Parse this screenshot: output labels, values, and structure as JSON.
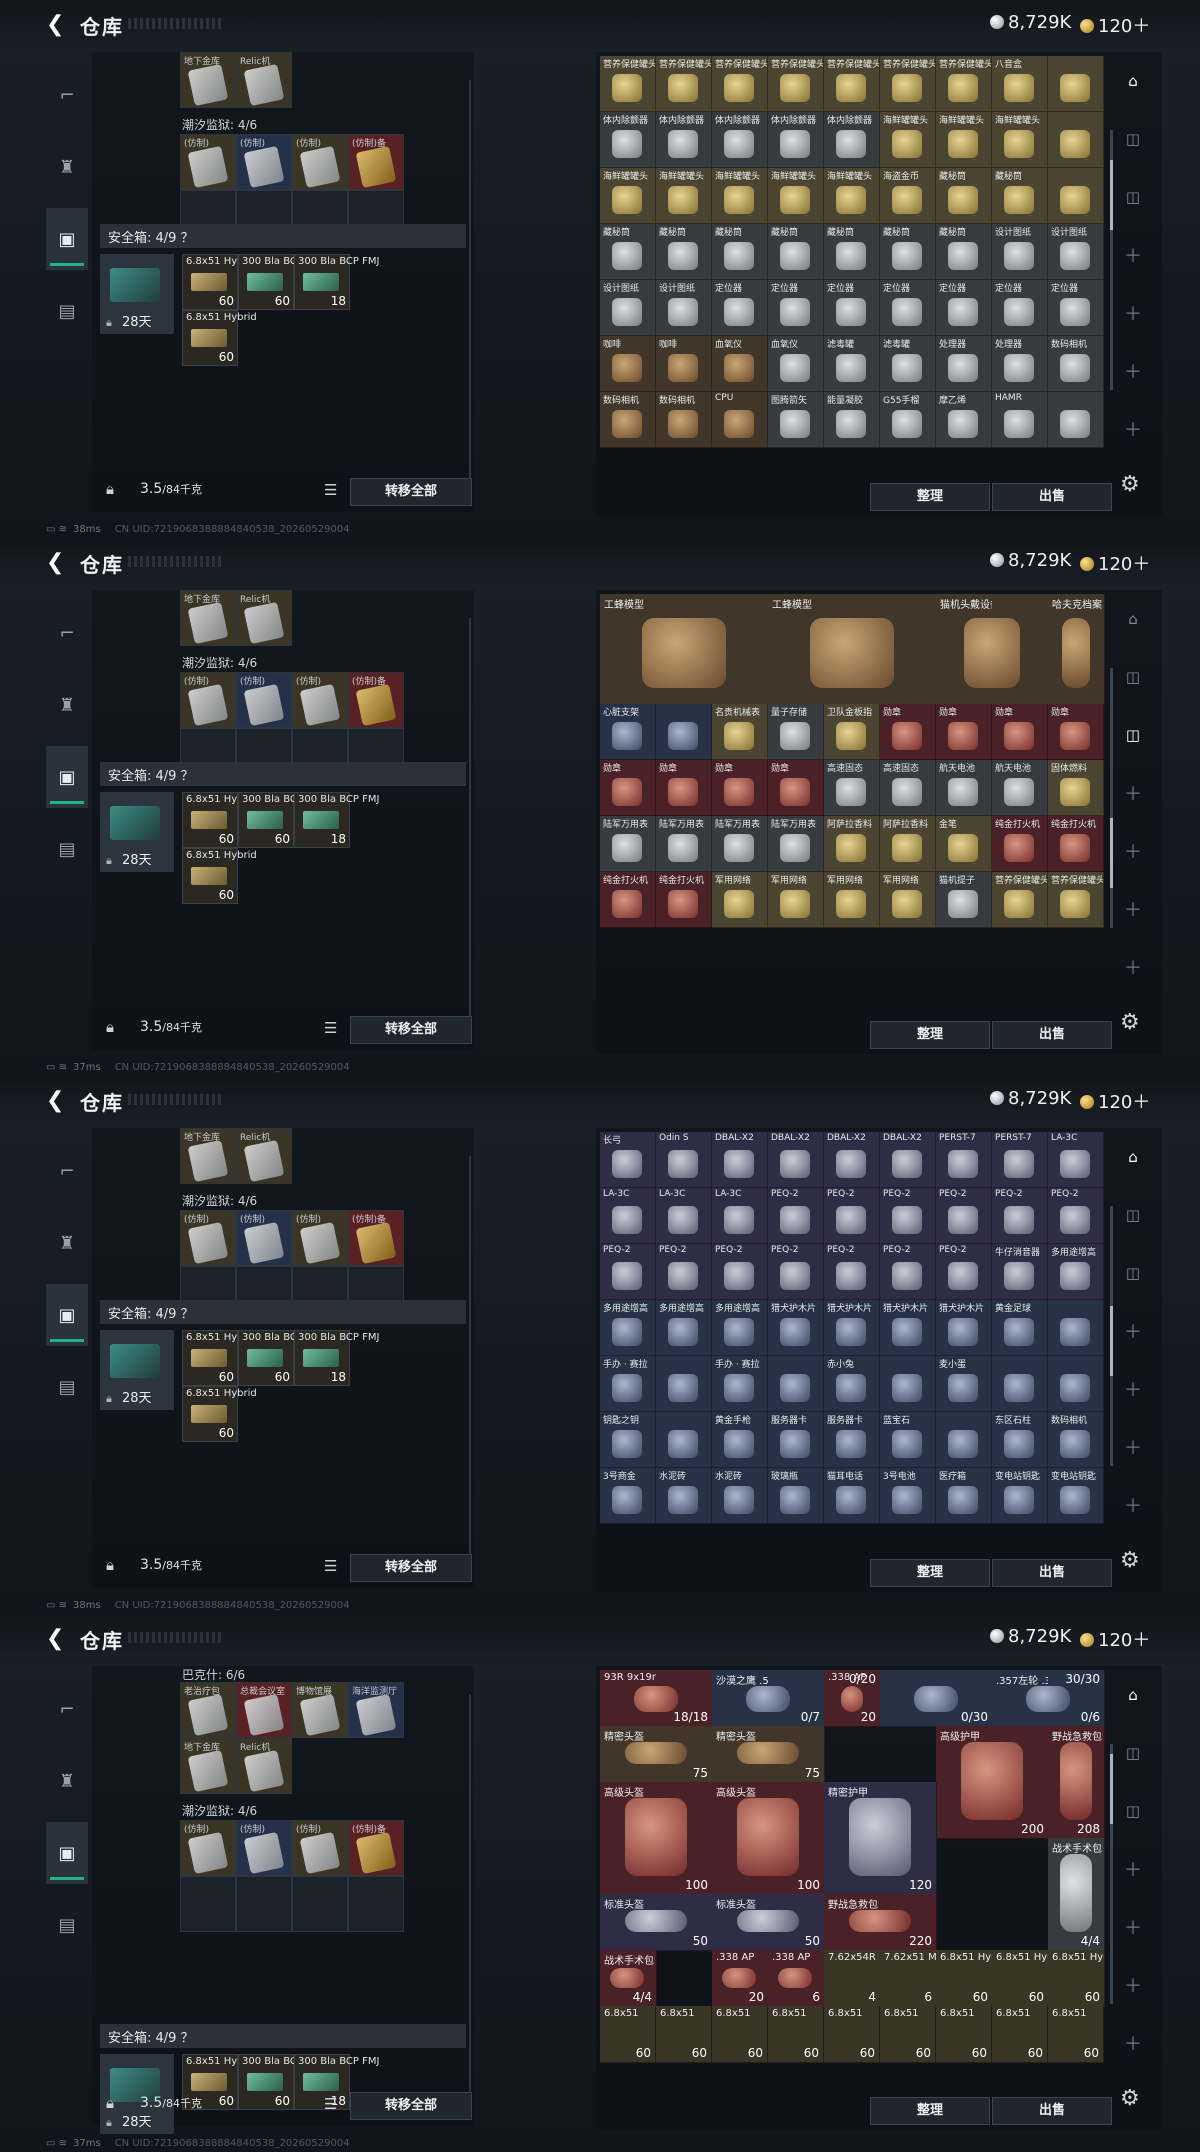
{
  "header": {
    "title": "仓库",
    "silver": "8,729K",
    "gold": "120＋"
  },
  "footer": {
    "weight_value": "3.5",
    "weight_unit": "/84千克",
    "transfer_all": "转移全部",
    "sort": "整理",
    "sell": "出售"
  },
  "left": {
    "group_a_label": "巴克什: 6/6",
    "group_a_items": [
      "老治疗包",
      "总裁会议室",
      "博物馆展",
      "海洋监测厅"
    ],
    "group_b_items": [
      "地下金库",
      "Relic机"
    ],
    "group_c_label": "潮汐监狱: 4/6",
    "group_c_items": [
      "(仿制)",
      "(仿制)",
      "(仿制)",
      "(仿制)备"
    ],
    "safe_label": "安全箱: 4/9 ？",
    "case_days": "28天",
    "ammo": [
      {
        "name": "6.8x51 Hybrid",
        "count": "60"
      },
      {
        "name": "300 Bla BCP FMJ",
        "count": "60"
      },
      {
        "name": "300 Bla BCP FMJ",
        "count": "18"
      },
      {
        "name": "6.8x51 Hybrid",
        "count": "60"
      }
    ]
  },
  "status": {
    "uid": "CN UID:7219068388884840538_20260529004",
    "pings": [
      "38ms",
      "37ms",
      "38ms",
      "37ms"
    ]
  },
  "panel1_labels": [
    "营养保健罐头",
    "营养保健罐头",
    "营养保健罐头",
    "营养保健罐头",
    "营养保健罐头",
    "营养保健罐头",
    "营养保健罐头",
    "八音盒",
    "",
    "体内除颤器",
    "体内除颤器",
    "体内除颤器",
    "体内除颤器",
    "体内除颤器",
    "海鲜罐罐头",
    "海鲜罐罐头",
    "海鲜罐罐头",
    "",
    "海鲜罐罐头",
    "海鲜罐罐头",
    "海鲜罐罐头",
    "海鲜罐罐头",
    "海鲜罐罐头",
    "海盗金币",
    "藏秘筒",
    "藏秘筒",
    "",
    "藏秘筒",
    "藏秘筒",
    "藏秘筒",
    "藏秘筒",
    "藏秘筒",
    "藏秘筒",
    "藏秘筒",
    "设计图纸",
    "设计图纸",
    "设计图纸",
    "设计图纸",
    "定位器",
    "定位器",
    "定位器",
    "定位器",
    "定位器",
    "定位器",
    "定位器",
    "咖啡",
    "咖啡",
    "血氧仪",
    "血氧仪",
    "滤毒罐",
    "滤毒罐",
    "处理器",
    "处理器",
    "数码相机",
    "数码相机",
    "数码相机",
    "CPU",
    "图腾箭矢",
    "能量凝胶",
    "G55手榴",
    "摩乙烯",
    "HAMR",
    ""
  ],
  "panel2_labels": {
    "big": [
      "工蜂模型",
      "工蜂模型",
      "猫机头戴设备",
      "哈夫克档案"
    ],
    "rows": [
      "心脏支架",
      "",
      "名贵机械表",
      "量子存储",
      "卫队金板指",
      "勋章",
      "勋章",
      "勋章",
      "勋章",
      "勋章",
      "勋章",
      "勋章",
      "勋章",
      "高速固态",
      "高速固态",
      "航天电池",
      "航天电池",
      "固体燃料",
      "陆军万用表",
      "陆军万用表",
      "陆军万用表",
      "陆军万用表",
      "阿萨拉香料",
      "阿萨拉香料",
      "金笔",
      "纯金打火机",
      "纯金打火机",
      "纯金打火机",
      "纯金打火机",
      "军用网络",
      "军用网络",
      "军用网络",
      "军用网络",
      "猫机提子",
      "营养保健罐头",
      "营养保健罐头"
    ]
  },
  "panel3_labels": [
    "长弓",
    "Odin S",
    "DBAL-X2",
    "DBAL-X2",
    "DBAL-X2",
    "DBAL-X2",
    "PERST-7",
    "PERST-7",
    "LA-3C",
    "LA-3C",
    "LA-3C",
    "LA-3C",
    "PEQ-2",
    "PEQ-2",
    "PEQ-2",
    "PEQ-2",
    "PEQ-2",
    "PEQ-2",
    "PEQ-2",
    "PEQ-2",
    "PEQ-2",
    "PEQ-2",
    "PEQ-2",
    "PEQ-2",
    "PEQ-2",
    "牛仔消音器",
    "多用途增高",
    "多用途增高",
    "多用途增高",
    "多用途增高",
    "猎犬护木片",
    "猎犬护木片",
    "猎犬护木片",
    "猎犬护木片",
    "黄金足球",
    "",
    "手办 · 赛拉",
    "",
    "手办 · 赛拉",
    "",
    "赤小兔",
    "",
    "麦小蛋",
    "",
    "",
    "钥匙之钥",
    "",
    "黄金手枪",
    "服务器卡",
    "服务器卡",
    "蓝宝石",
    "",
    "东区石柱",
    "数码相机",
    "3号商金",
    "水泥砖",
    "水泥砖",
    "玻璃瓶",
    "猫耳电话",
    "3号电池",
    "医疗箱",
    "变电站钥匙",
    "变电站钥匙"
  ],
  "panel4": {
    "row0": [
      {
        "name": "93R 9x19mm",
        "count": "18/18"
      },
      {
        "name": "沙漠之鹰 .50AE",
        "count": "0/7"
      },
      {
        "name": ".338 AP",
        "count": "20",
        "top": "0/20"
      },
      {
        "name": "",
        "count": "0/30"
      },
      {
        "name": ".357左轮 .357",
        "count": "0/6",
        "top": "30/30"
      }
    ],
    "mid": [
      {
        "name": "精密头盔",
        "val": "75"
      },
      {
        "name": "精密头盔",
        "val": "75"
      },
      {
        "name": "高级护甲",
        "val": "200"
      },
      {
        "name": "野战急救包",
        "val": "208"
      },
      {
        "name": "高级头盔",
        "val": "100"
      },
      {
        "name": "高级头盔",
        "val": "100"
      },
      {
        "name": "精密护甲",
        "val": "120"
      },
      {
        "name": "战术手术包",
        "val": "4/4"
      },
      {
        "name": "标准头盔",
        "val": "50"
      },
      {
        "name": "标准头盔",
        "val": "50"
      },
      {
        "name": "野战急救包",
        "val": "220"
      }
    ],
    "ammo_row": [
      {
        "name": "战术手术包",
        "count": "4/4"
      },
      {
        "name": ".338 AP",
        "count": "20"
      },
      {
        "name": ".338 AP",
        "count": "6"
      },
      {
        "name": "7.62x54R",
        "count": "4"
      },
      {
        "name": "7.62x51 M62",
        "count": "6"
      },
      {
        "name": "6.8x51 Hybrid",
        "count": "60"
      },
      {
        "name": "6.8x51 Hybrid",
        "count": "60"
      },
      {
        "name": "6.8x51 Hybrid",
        "count": "60"
      }
    ],
    "last_row": [
      "6.8x51",
      "6.8x51",
      "6.8x51",
      "6.8x51",
      "6.8x51",
      "6.8x51",
      "6.8x51",
      "6.8x51",
      "6.8x51"
    ],
    "last_count": "60"
  }
}
